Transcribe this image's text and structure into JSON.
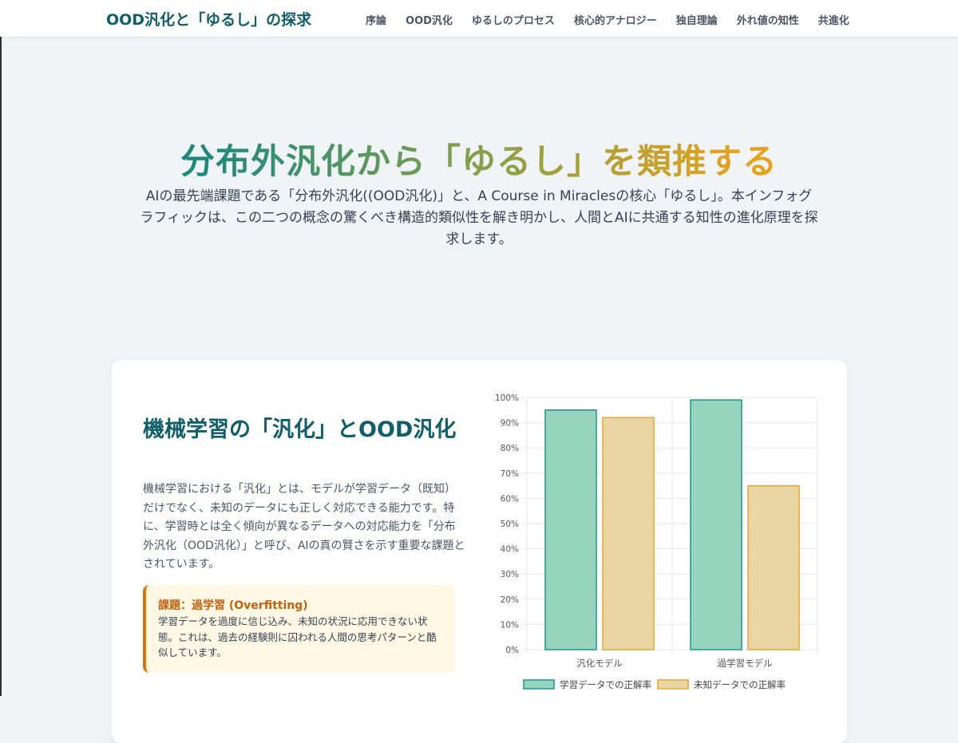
{
  "nav": {
    "brand": "OOD汎化と「ゆるし」の探求",
    "links": [
      "序論",
      "OOD汎化",
      "ゆるしのプロセス",
      "核心的アナロジー",
      "独自理論",
      "外れ値の知性",
      "共進化"
    ]
  },
  "hero": {
    "title": "分布外汎化から「ゆるし」を類推する",
    "subtitle": "AIの最先端課題である「分布外汎化((OOD汎化)」と、A Course in Miraclesの核心「ゆるし」。本インフォグラフィックは、この二つの概念の驚くべき構造的類似性を解き明かし、人間とAIに共通する知性の進化原理を探求します。"
  },
  "section": {
    "title": "機械学習の「汎化」とOOD汎化",
    "body": "機械学習における「汎化」とは、モデルが学習データ（既知）だけでなく、未知のデータにも正しく対応できる能力です。特に、学習時とは全く傾向が異なるデータへの対応能力を「分布外汎化（OOD汎化）」と呼び、AIの真の賢さを示す重要な課題とされています。",
    "callout": {
      "title": "課題：過学習 (Overfitting)",
      "body": "学習データを過度に信じ込み、未知の状況に応用できない状態。これは、過去の経験則に囚われる人間の思考パターンと酷似しています。"
    }
  },
  "colors": {
    "brand": "#0f5e68",
    "train_fill": "#96d4bd",
    "train_stroke": "#1c968a",
    "unseen_fill": "#ead6a4",
    "unseen_stroke": "#e6a532"
  },
  "chart_data": {
    "type": "bar",
    "categories": [
      "汎化モデル",
      "過学習モデル"
    ],
    "series": [
      {
        "name": "学習データでの正解率",
        "values": [
          95,
          99
        ]
      },
      {
        "name": "未知データでの正解率",
        "values": [
          92,
          65
        ]
      }
    ],
    "ylim": [
      0,
      100
    ],
    "yticks": [
      "0%",
      "10%",
      "20%",
      "30%",
      "40%",
      "50%",
      "60%",
      "70%",
      "80%",
      "90%",
      "100%"
    ],
    "grid": true,
    "legend": "bottom"
  }
}
